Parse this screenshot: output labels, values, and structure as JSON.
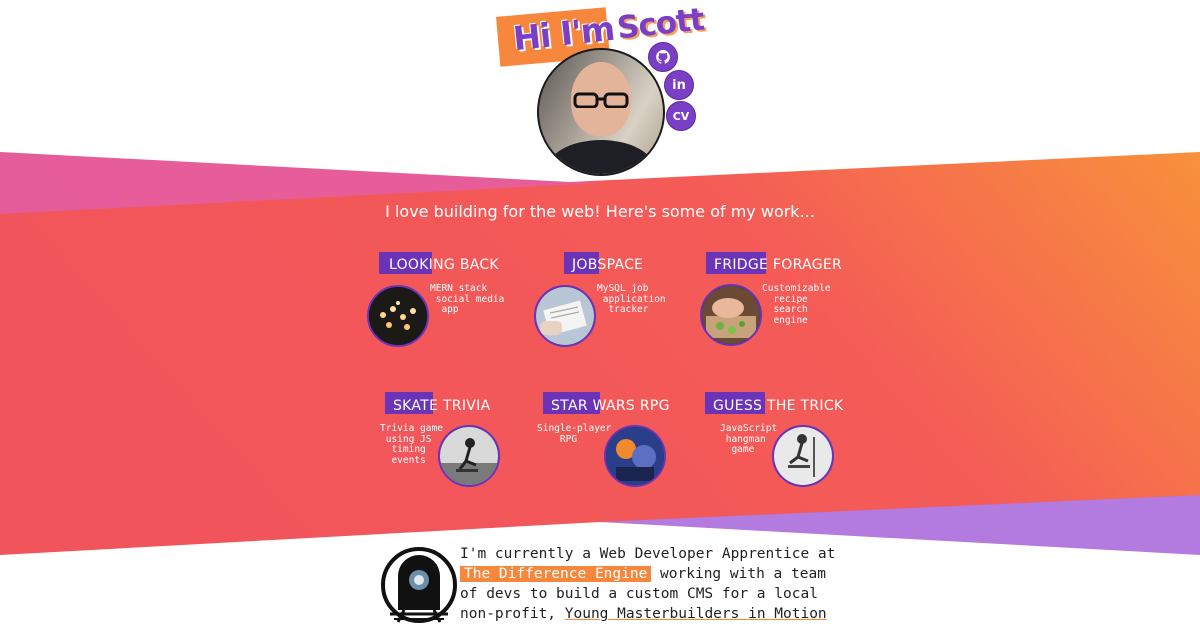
{
  "header": {
    "greeting": "Hi I'm",
    "name": "Scott",
    "social": [
      {
        "icon": "github-icon",
        "label": ""
      },
      {
        "icon": "linkedin-icon",
        "label": "in"
      },
      {
        "icon": "cv-icon",
        "label": "CV"
      }
    ]
  },
  "intro": "I love building for the web! Here's some of my work...",
  "projects": [
    {
      "title": "LOOKING BACK",
      "description": "MERN stack\n social media\n  app"
    },
    {
      "title": "JOBSPACE",
      "description": "MySQL job\n application\n  tracker"
    },
    {
      "title": "FRIDGE FORAGER",
      "description": "Customizable\n  recipe\n  search\n  engine"
    },
    {
      "title": "SKATE TRIVIA",
      "description": "Trivia game\n using JS\n  timing\n  events"
    },
    {
      "title": "STAR WARS RPG",
      "description": "Single-player\n    RPG"
    },
    {
      "title": "GUESS THE TRICK",
      "description": "JavaScript\n hangman\n  game"
    }
  ],
  "about": {
    "line1": "I'm currently a Web Developer Apprentice at",
    "company": "The Difference Engine",
    "line2": " working with a team",
    "line3": "of devs to build a custom CMS for a local",
    "line4": "non-profit, ",
    "org": "Young Masterbuilders in Motion"
  },
  "colors": {
    "accent_orange": "#f7873d",
    "accent_purple": "#7a3fc5",
    "band_red": "#f2545b",
    "band_pink": "#d85fb8"
  }
}
